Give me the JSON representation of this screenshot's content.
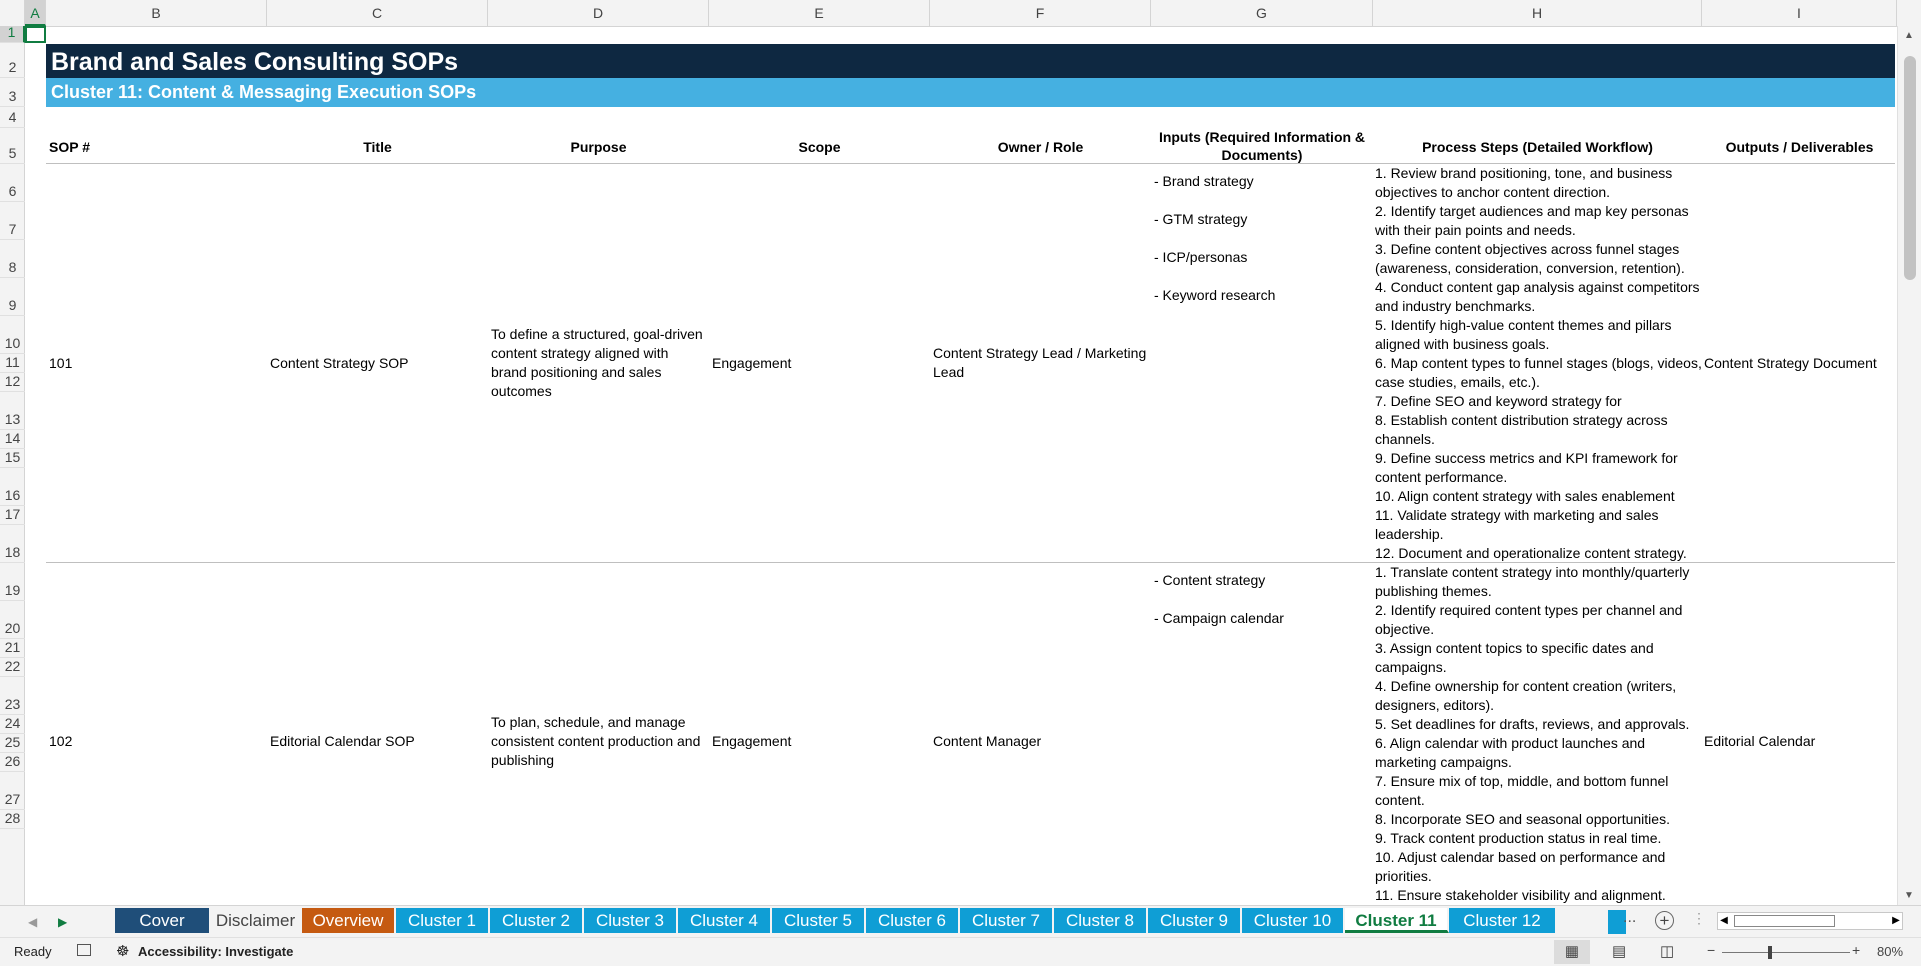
{
  "sheet": {
    "columns": [
      "A",
      "B",
      "C",
      "D",
      "E",
      "F",
      "G",
      "H",
      "I"
    ],
    "selected_column": "A",
    "rows": [
      "1",
      "2",
      "3",
      "4",
      "5",
      "6",
      "7",
      "8",
      "9",
      "10",
      "11",
      "12",
      "13",
      "14",
      "15",
      "16",
      "17",
      "18",
      "19",
      "20",
      "21",
      "22",
      "23",
      "24",
      "25",
      "26",
      "27",
      "28"
    ],
    "selected_row": "1",
    "title": "Brand and Sales Consulting SOPs",
    "subtitle": "Cluster 11: Content & Messaging Execution SOPs",
    "headers": {
      "sop": "SOP #",
      "title": "Title",
      "purpose": "Purpose",
      "scope": "Scope",
      "owner": "Owner / Role",
      "inputs": "Inputs (Required Information & Documents)",
      "steps": "Process Steps (Detailed Workflow)",
      "outputs": "Outputs / Deliverables"
    },
    "records": [
      {
        "sop": "101",
        "title": "Content Strategy SOP",
        "purpose": "To define a structured, goal-driven content strategy aligned with brand positioning and sales outcomes",
        "scope": "Engagement",
        "owner": "Content Strategy Lead / Marketing Lead",
        "inputs": [
          "- Brand strategy",
          "- GTM strategy",
          "- ICP/personas",
          "- Keyword research"
        ],
        "steps": [
          "1. Review brand positioning, tone, and business",
          "objectives to anchor content direction.",
          "2. Identify target audiences and map key personas",
          "with their pain points and needs.",
          "3. Define content objectives across funnel stages",
          "(awareness, consideration, conversion, retention).",
          "4. Conduct content gap analysis against competitors",
          "and industry benchmarks.",
          "5. Identify high-value content themes and pillars",
          "aligned with business goals.",
          "6. Map content types to funnel stages (blogs, videos,",
          "case studies, emails, etc.).",
          "7. Define SEO and keyword strategy for",
          "8. Establish content distribution strategy across",
          "channels.",
          "9. Define success metrics and KPI framework for",
          "content performance.",
          "10. Align content strategy with sales enablement",
          "11. Validate strategy with marketing and sales",
          "leadership.",
          "12. Document and operationalize content strategy."
        ],
        "outputs": "Content Strategy Document"
      },
      {
        "sop": "102",
        "title": "Editorial Calendar SOP",
        "purpose": "To plan, schedule, and manage consistent content production and publishing",
        "scope": "Engagement",
        "owner": "Content Manager",
        "inputs": [
          "- Content strategy",
          "- Campaign calendar"
        ],
        "steps": [
          "1. Translate content strategy into monthly/quarterly",
          "publishing themes.",
          "2. Identify required content types per channel and",
          "objective.",
          "3. Assign content topics to specific dates and",
          "campaigns.",
          "4. Define ownership for content creation (writers,",
          "designers, editors).",
          "5. Set deadlines for drafts, reviews, and approvals.",
          "6. Align calendar with product launches and",
          "marketing campaigns.",
          "7. Ensure mix of top, middle, and bottom funnel",
          "content.",
          "8. Incorporate SEO and seasonal opportunities.",
          "9. Track content production status in real time.",
          "10. Adjust calendar based on performance and",
          "priorities.",
          "11. Ensure stakeholder visibility and alignment."
        ],
        "outputs": "Editorial Calendar"
      }
    ]
  },
  "tabs": {
    "items": [
      {
        "label": "Cover Sheet",
        "bg": "#1f4e79",
        "fg": "#ffffff"
      },
      {
        "label": "Disclaimer",
        "bg": "#f3f3f3",
        "fg": "#444444"
      },
      {
        "label": "Overview",
        "bg": "#c55a11",
        "fg": "#ffffff"
      },
      {
        "label": "Cluster 1",
        "bg": "#0f9ed5",
        "fg": "#ffffff"
      },
      {
        "label": "Cluster 2",
        "bg": "#0f9ed5",
        "fg": "#ffffff"
      },
      {
        "label": "Cluster 3",
        "bg": "#0f9ed5",
        "fg": "#ffffff"
      },
      {
        "label": "Cluster 4",
        "bg": "#0f9ed5",
        "fg": "#ffffff"
      },
      {
        "label": "Cluster 5",
        "bg": "#0f9ed5",
        "fg": "#ffffff"
      },
      {
        "label": "Cluster 6",
        "bg": "#0f9ed5",
        "fg": "#ffffff"
      },
      {
        "label": "Cluster 7",
        "bg": "#0f9ed5",
        "fg": "#ffffff"
      },
      {
        "label": "Cluster 8",
        "bg": "#0f9ed5",
        "fg": "#ffffff"
      },
      {
        "label": "Cluster 9",
        "bg": "#0f9ed5",
        "fg": "#ffffff"
      },
      {
        "label": "Cluster 10",
        "bg": "#0f9ed5",
        "fg": "#ffffff"
      },
      {
        "label": "Cluster 11",
        "bg": "#ffffff",
        "fg": "#107c41"
      },
      {
        "label": "Cluster 12",
        "bg": "#0f9ed5",
        "fg": "#ffffff"
      }
    ],
    "active": "Cluster 11",
    "more": "...",
    "add": "+"
  },
  "status": {
    "ready": "Ready",
    "accessibility": "Accessibility: Investigate",
    "zoom": "80%"
  },
  "colors": {
    "banner_dark": "#0e2841",
    "banner_light": "#45b0e1",
    "excel_green": "#107c41"
  }
}
